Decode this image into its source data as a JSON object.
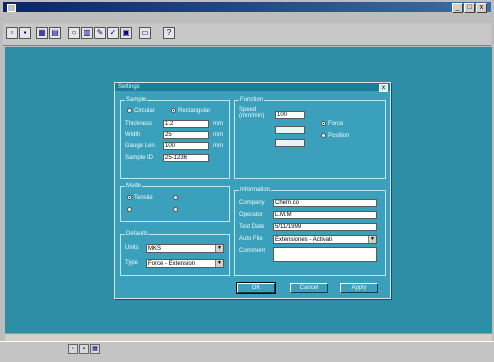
{
  "window": {
    "title": "",
    "caption_buttons": [
      "_",
      "□",
      "x"
    ]
  },
  "menubar": {
    "items": []
  },
  "toolbar": {
    "icons": [
      "open-icon",
      "save-icon",
      "grid-icon",
      "calc-icon",
      "zoom-icon",
      "chart-icon",
      "check-icon",
      "edit-icon",
      "help-icon"
    ]
  },
  "dialog": {
    "title": "Settings",
    "close": "x",
    "sample": {
      "group_label": "Sample",
      "shape_options": [
        "Circular",
        "Rectangular"
      ],
      "selected_shape": "Rectangular",
      "fields": [
        {
          "label": "Thickness",
          "value": "1.2",
          "unit": "mm"
        },
        {
          "label": "Width",
          "value": "25",
          "unit": "mm"
        },
        {
          "label": "Gauge Len.",
          "value": "100",
          "unit": "mm"
        },
        {
          "label": "Sample ID",
          "value": "25-1236",
          "unit": ""
        }
      ]
    },
    "function": {
      "group_label": "Function",
      "fields": [
        {
          "label": "Speed (mm/min)",
          "value": "100"
        },
        {
          "label": "",
          "value": ""
        },
        {
          "label": "",
          "value": ""
        }
      ],
      "options": [
        "Force",
        "Position"
      ],
      "selected": "Force"
    },
    "mode": {
      "group_label": "Mode",
      "options": [
        "Tensile",
        "",
        "",
        ""
      ],
      "selected": "Tensile"
    },
    "defaults": {
      "group_label": "Defaults",
      "units_label": "Units",
      "units_value": "MKS",
      "type_label": "Type",
      "type_value": "Force - Extension"
    },
    "information": {
      "group_label": "Information",
      "fields": [
        {
          "label": "Company",
          "value": "Chem co"
        },
        {
          "label": "Operator",
          "value": "L.M.M"
        },
        {
          "label": "Test Date",
          "value": "5/11/1999"
        },
        {
          "label": "Auto File",
          "value": "Extensiones - Activati"
        },
        {
          "label": "Comment",
          "value": ""
        }
      ]
    },
    "buttons": {
      "ok": "OK",
      "cancel": "Cancel",
      "apply": "Apply"
    }
  },
  "taskbar": {
    "left_text": "",
    "tray": [
      "",
      ""
    ]
  }
}
